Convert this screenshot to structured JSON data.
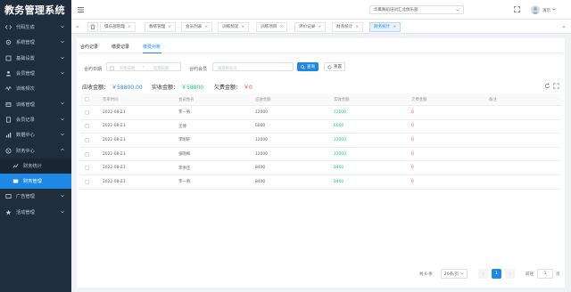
{
  "app": {
    "title": "教务管理系统"
  },
  "sidebar": {
    "items": [
      {
        "label": "代码生成",
        "icon": "code-icon"
      },
      {
        "label": "系统管理",
        "icon": "gear-icon"
      },
      {
        "label": "基础设置",
        "icon": "settings-icon"
      },
      {
        "label": "会员管理",
        "icon": "user-icon"
      },
      {
        "label": "训练频次",
        "icon": "frequency-icon"
      },
      {
        "label": "训练管理",
        "icon": "training-icon"
      },
      {
        "label": "会员记录",
        "icon": "record-icon"
      },
      {
        "label": "数据中心",
        "icon": "data-icon"
      },
      {
        "label": "财务中心",
        "icon": "finance-icon"
      },
      {
        "label": "财务统计",
        "icon": "stats-icon"
      },
      {
        "label": "财务管理",
        "icon": "wallet-icon"
      },
      {
        "label": "广告管理",
        "icon": "ad-icon"
      },
      {
        "label": "活动管理",
        "icon": "activity-icon"
      }
    ]
  },
  "header": {
    "org": "华鹰舞蹈培训汇北俱乐部",
    "user": "演示"
  },
  "tabs": [
    {
      "label": "俱乐部管理"
    },
    {
      "label": "教练管理"
    },
    {
      "label": "会员列表"
    },
    {
      "label": "训练频次"
    },
    {
      "label": "训练项目"
    },
    {
      "label": "评价记录"
    },
    {
      "label": "财务统计"
    },
    {
      "label": "财务统计"
    }
  ],
  "subtabs": [
    "合约记录",
    "缴费记录",
    "缴费对账"
  ],
  "filters": {
    "date_label": "合约日期",
    "start_placeholder": "开始日期",
    "dash": "-",
    "end_placeholder": "结束日期",
    "member_label": "合约会员",
    "member_placeholder": "请选择会员",
    "search_btn": "查询",
    "reset_btn": "重置"
  },
  "summary": {
    "receivable_label": "应收金额：",
    "receivable_value": "￥58800.00",
    "received_label": "实收金额：",
    "received_value": "￥58800",
    "owed_label": "欠费金额：",
    "owed_value": "￥0"
  },
  "table": {
    "columns": [
      "签单时间",
      "会员姓名",
      "应收金额",
      "实收金额",
      "欠费金额",
      "备注"
    ],
    "rows": [
      [
        "2022-08-23",
        "李一男",
        "12000",
        "12000",
        "0",
        ""
      ],
      [
        "2022-08-23",
        "王博",
        "6000",
        "6000",
        "0",
        ""
      ],
      [
        "2022-08-23",
        "李明轩",
        "12000",
        "12000",
        "0",
        ""
      ],
      [
        "2022-08-23",
        "张晓梅",
        "12000",
        "12000",
        "0",
        ""
      ],
      [
        "2022-08-23",
        "李洪佳",
        "8400",
        "8400",
        "0",
        ""
      ],
      [
        "2022-08-23",
        "李一男",
        "8400",
        "8400",
        "0",
        ""
      ]
    ]
  },
  "pagination": {
    "total": "共 6 条",
    "page_size": "20条/页",
    "current": "1",
    "goto_label": "前往",
    "goto_value": "1",
    "page_suffix": "页"
  },
  "colors": {
    "accent": "#1e88e5",
    "sidebar_bg": "#1f2d3d",
    "positive": "#13ce66",
    "negative": "#ff4949"
  }
}
